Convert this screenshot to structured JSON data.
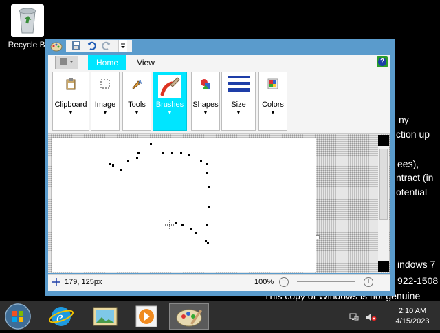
{
  "desktop": {
    "recycle_bin_label": "Recycle Bi",
    "background_text": [
      {
        "text": "ny"
      },
      {
        "text": "ction up"
      },
      {
        "text": "ees),"
      },
      {
        "text": "ntract (in"
      },
      {
        "text": "otential"
      },
      {
        "text": "indows 7"
      },
      {
        "text": "922-1508"
      },
      {
        "text": "This copy of Windows is not genuine"
      }
    ]
  },
  "paint": {
    "tabs": {
      "home": "Home",
      "view": "View"
    },
    "file_button_icon": "menu-icon",
    "help_glyph": "?",
    "ribbon_groups": {
      "clipboard": "Clipboard",
      "image": "Image",
      "tools": "Tools",
      "brushes": "Brushes",
      "shapes": "Shapes",
      "size": "Size",
      "colors": "Colors"
    },
    "status": {
      "coordinates": "179, 125px",
      "zoom": "100%",
      "zoom_out": "−",
      "zoom_in": "+"
    },
    "accent_color": "#00e5ff",
    "frame_color": "#5a9bcc"
  },
  "taskbar": {
    "time": "2:10 AM",
    "date": "4/15/2023",
    "items": [
      "internet-explorer",
      "photo-viewer",
      "media-player",
      "paint"
    ]
  }
}
